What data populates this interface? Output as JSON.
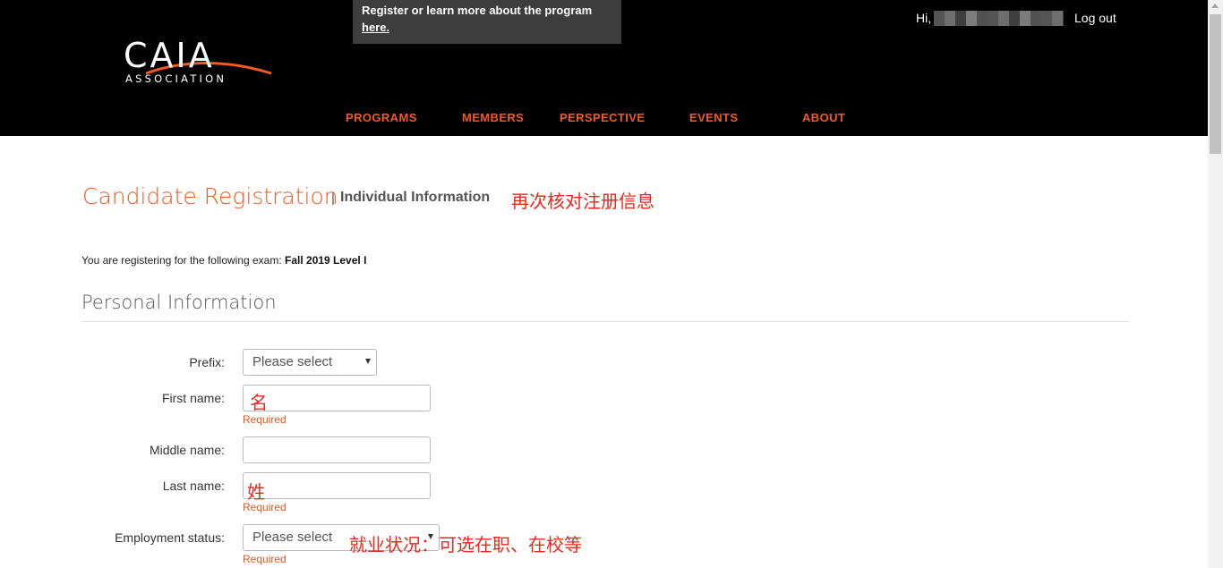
{
  "header": {
    "logo": {
      "main": "CAIA",
      "sub": "ASSOCIATION"
    },
    "promo": {
      "text": "Register or learn more about the program ",
      "link": "here."
    },
    "greeting": "Hi,",
    "logout": "Log out",
    "nav": [
      "PROGRAMS",
      "MEMBERS",
      "PERSPECTIVE",
      "EVENTS",
      "ABOUT"
    ]
  },
  "page": {
    "title": "Candidate Registration",
    "separator": "|",
    "subtitle": "Individual Information",
    "annotation": "再次核对注册信息",
    "exam_prefix": "You are registering for the following exam: ",
    "exam_name": "Fall 2019 Level I",
    "section_title": "Personal Information"
  },
  "form": {
    "prefix": {
      "label": "Prefix:",
      "value": "Please select"
    },
    "first_name": {
      "label": "First name:",
      "value": "名",
      "hint": "Required"
    },
    "middle_name": {
      "label": "Middle name:",
      "value": ""
    },
    "last_name": {
      "label": "Last name:",
      "value": "姓",
      "hint": "Required"
    },
    "employment_status": {
      "label": "Employment status:",
      "value": "Please select",
      "hint": "Required",
      "annotation": "就业状况：可选在职、在校等"
    }
  },
  "colors": {
    "accent": "#f15a22",
    "annotation": "#e8281e",
    "topbar": "#000000"
  }
}
